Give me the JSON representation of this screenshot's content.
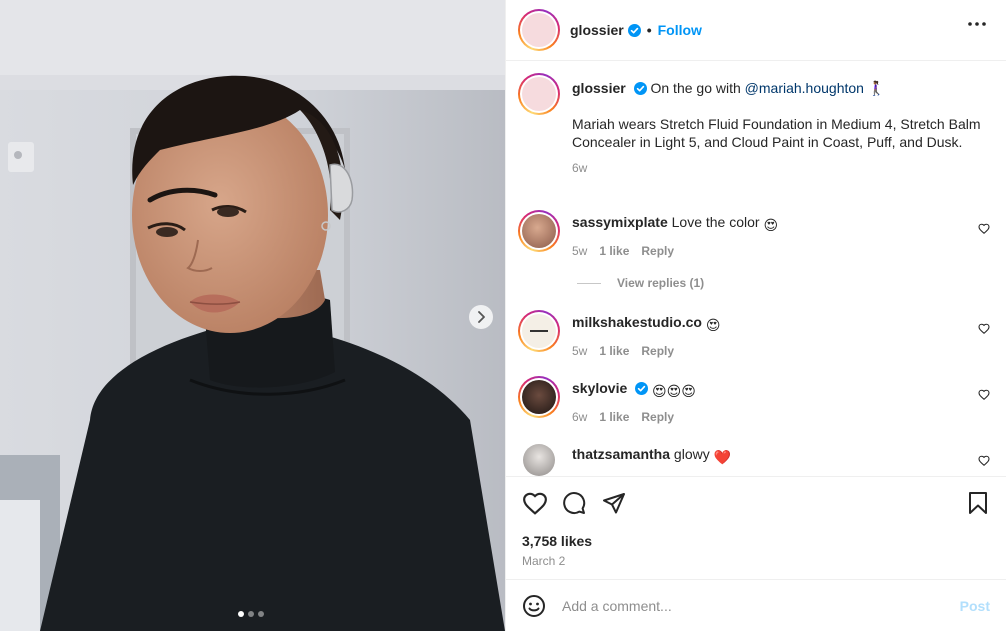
{
  "header": {
    "username": "glossier",
    "separator": "•",
    "follow_label": "Follow",
    "more_icon": "more-horizontal-icon"
  },
  "caption": {
    "username": "glossier",
    "text_before": "On the go with ",
    "mention": "@mariah.houghton",
    "text_emoji": "🚶🏾‍♀️",
    "paragraph": "Mariah wears Stretch Fluid Foundation in Medium 4, Stretch Balm Concealer in Light 5, and Cloud Paint in Coast, Puff, and Dusk.",
    "time": "6w"
  },
  "comments": [
    {
      "username": "sassymixplate",
      "text": "Love the color",
      "emoji": "😍",
      "time": "5w",
      "likes": "1 like",
      "reply": "Reply"
    },
    {
      "username": "milkshakestudio.co",
      "text": "",
      "emoji": "😍",
      "time": "5w",
      "likes": "1 like",
      "reply": "Reply"
    },
    {
      "username": "skylovie",
      "text": "",
      "emoji": "😍😍😍",
      "time": "6w",
      "likes": "1 like",
      "reply": "Reply"
    },
    {
      "username": "thatzsamantha",
      "text": "glowy",
      "emoji": "❤️"
    }
  ],
  "view_replies": "View replies (1)",
  "likes_count": "3,758 likes",
  "date": "March 2",
  "comment_input": {
    "placeholder": "Add a comment...",
    "post_label": "Post"
  },
  "carousel": {
    "total": 3,
    "current": 1
  },
  "colors": {
    "accent": "#0095f6",
    "post_disabled": "#b2dffc",
    "muted": "#8e8e8e"
  }
}
